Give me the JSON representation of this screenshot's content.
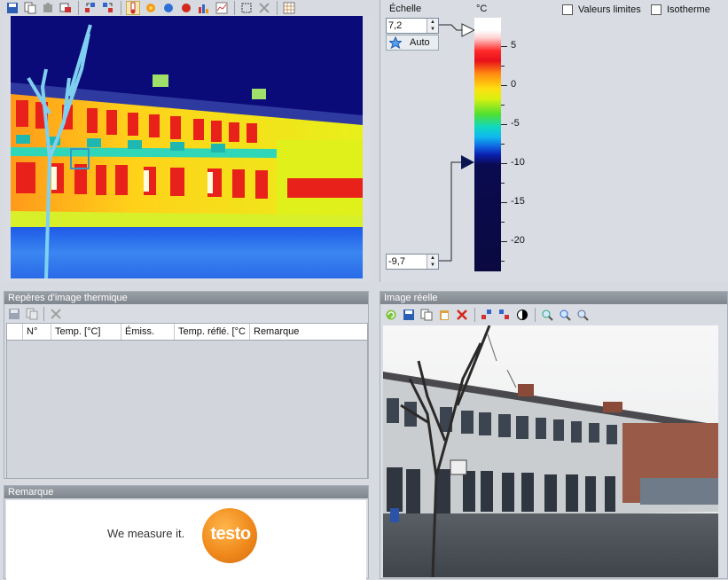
{
  "scale": {
    "label": "Échelle",
    "unit": "°C",
    "max_value": "7,2",
    "min_value": "-9,7",
    "auto_label": "Auto",
    "ticks": [
      "5",
      "0",
      "-5",
      "-10",
      "-15",
      "-20"
    ]
  },
  "options": {
    "limits_label": "Valeurs limites",
    "isotherm_label": "Isotherme"
  },
  "markers_panel": {
    "title": "Repères d'image thermique",
    "columns": [
      "N°",
      "Temp. [°C]",
      "Émiss.",
      "Temp. réflé. [°C",
      "Remarque"
    ]
  },
  "remark_panel": {
    "title": "Remarque",
    "slogan": "We measure it.",
    "logo_text": "testo"
  },
  "real_image_panel": {
    "title": "Image réelle"
  },
  "colors": {
    "panel_title": "#8a9099",
    "logo_orange": "#f08a1c",
    "thermal_sky": "#0a0a78"
  }
}
